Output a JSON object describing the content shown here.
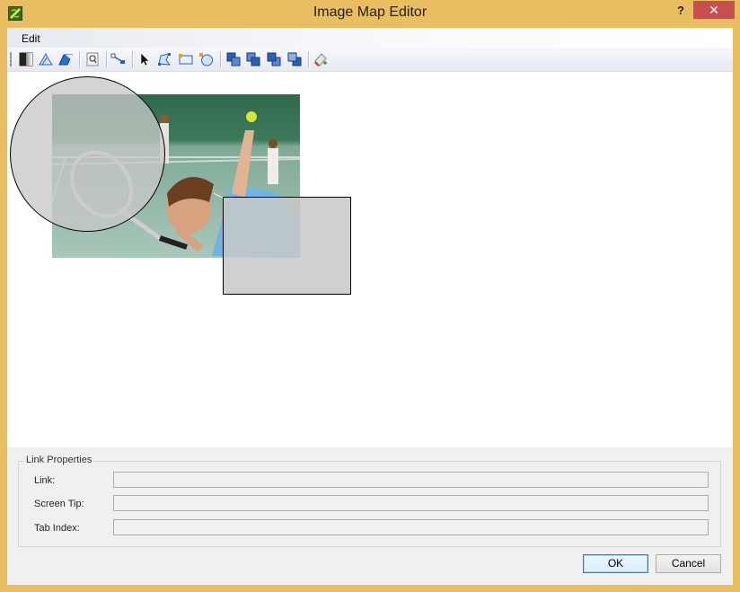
{
  "window": {
    "title": "Image Map Editor",
    "help_glyph": "?",
    "close_glyph": "✕",
    "frame_color": "#e9be63",
    "icon": "app-logo-icon"
  },
  "menu": {
    "items": [
      {
        "label": "Edit"
      }
    ]
  },
  "toolbar": {
    "buttons": [
      {
        "name": "image-properties-icon"
      },
      {
        "name": "image-flip-icon"
      },
      {
        "name": "image-shape-icon"
      },
      {
        "name": "zoom-icon"
      },
      {
        "name": "line-icon"
      },
      {
        "name": "pointer-icon"
      },
      {
        "name": "polygon-tool-icon"
      },
      {
        "name": "rectangle-tool-icon"
      },
      {
        "name": "circle-tool-icon"
      },
      {
        "name": "bring-to-front-icon"
      },
      {
        "name": "bring-forward-icon"
      },
      {
        "name": "send-backward-icon"
      },
      {
        "name": "send-to-back-icon"
      },
      {
        "name": "clear-icon"
      }
    ]
  },
  "canvas": {
    "image_description_icon": "tennis-photo-image",
    "hotspots": [
      {
        "shape": "circle"
      },
      {
        "shape": "rectangle"
      }
    ]
  },
  "link_properties": {
    "group_label": "Link Properties",
    "link_label": "Link:",
    "link_value": "",
    "screen_tip_label": "Screen Tip:",
    "screen_tip_value": "",
    "tab_index_label": "Tab Index:",
    "tab_index_value": ""
  },
  "footer": {
    "ok_label": "OK",
    "cancel_label": "Cancel"
  }
}
